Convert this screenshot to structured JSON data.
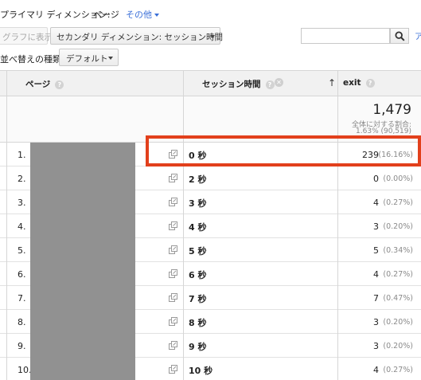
{
  "dimension_bar": {
    "primary_label": "プライマリ ディメンション:",
    "primary_value": "ページ",
    "other_label": "その他"
  },
  "toolbar": {
    "graph_button": "グラフに表示",
    "secondary_dimension": "セカンダリ ディメンション: セッション時間",
    "search_placeholder": "",
    "advanced_link": "ア",
    "sort_label": "並べ替えの種類:",
    "sort_value": "デフォルト"
  },
  "table": {
    "headers": {
      "page": "ページ",
      "session_time": "セッション時間",
      "exit": "exit"
    },
    "summary": {
      "total": "1,479",
      "pct_label": "全体に対する割合:",
      "pct_value": "1.63% (90,519)"
    },
    "rows": [
      {
        "num": "1.",
        "session": "0 秒",
        "exit": "239",
        "pct": "(16.16%)"
      },
      {
        "num": "2.",
        "session": "2 秒",
        "exit": "0",
        "pct": "(0.00%)"
      },
      {
        "num": "3.",
        "session": "3 秒",
        "exit": "4",
        "pct": "(0.27%)"
      },
      {
        "num": "4.",
        "session": "4 秒",
        "exit": "3",
        "pct": "(0.20%)"
      },
      {
        "num": "5.",
        "session": "5 秒",
        "exit": "5",
        "pct": "(0.34%)"
      },
      {
        "num": "6.",
        "session": "6 秒",
        "exit": "4",
        "pct": "(0.27%)"
      },
      {
        "num": "7.",
        "session": "7 秒",
        "exit": "7",
        "pct": "(0.47%)"
      },
      {
        "num": "8.",
        "session": "8 秒",
        "exit": "3",
        "pct": "(0.20%)"
      },
      {
        "num": "9.",
        "session": "9 秒",
        "exit": "3",
        "pct": "(0.20%)"
      },
      {
        "num": "10.",
        "session": "10 秒",
        "exit": "4",
        "pct": "(0.27%)"
      }
    ]
  },
  "icons": {
    "help": "help-icon",
    "close": "close-icon",
    "search": "search-icon",
    "open_link": "open-link-icon"
  },
  "colors": {
    "highlight": "#e2401c",
    "link": "#3a6fd8",
    "redaction": "#919191"
  }
}
